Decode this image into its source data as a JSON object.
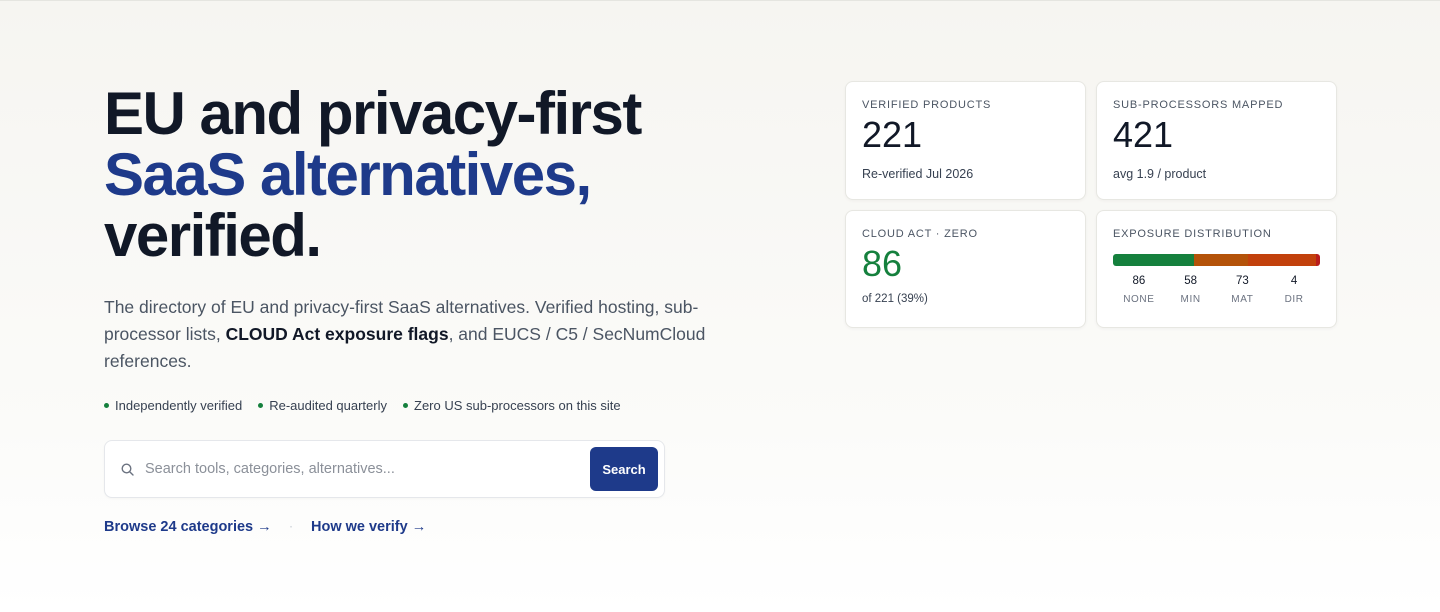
{
  "hero": {
    "headline_line1": "EU and privacy-first",
    "headline_line2": "SaaS alternatives,",
    "headline_line3": "verified.",
    "description_part1": "The directory of EU and privacy-first SaaS alternatives. Verified hosting, sub-processor lists, ",
    "description_strong": "CLOUD Act exposure flags",
    "description_part2": ", and EUCS / C5 / SecNumCloud references.",
    "badges": [
      "Independently verified",
      "Re-audited quarterly",
      "Zero US sub-processors on this site"
    ],
    "search": {
      "placeholder": "Search tools, categories, alternatives...",
      "value": "",
      "button_label": "Search",
      "icon": "search-icon"
    },
    "links": [
      "Browse 24 categories →",
      "How we verify →"
    ],
    "link_separator": "·"
  },
  "stats": {
    "verified_products": {
      "label": "VERIFIED PRODUCTS",
      "value": "221",
      "sub": "Re-verified Jul 2026"
    },
    "sub_processors": {
      "label": "SUB-PROCESSORS MAPPED",
      "value": "421",
      "sub": "avg 1.9 / product"
    },
    "cloud_act": {
      "label": "CLOUD ACT · ZERO",
      "value": "86",
      "sub": "of 221 (39%)"
    },
    "exposure": {
      "label": "EXPOSURE DISTRIBUTION",
      "segments": [
        {
          "count": 86,
          "label": "NONE",
          "color": "#15803d"
        },
        {
          "count": 58,
          "label": "MIN",
          "color": "#b45309"
        },
        {
          "count": 73,
          "label": "MAT",
          "color": "#c2410c"
        },
        {
          "count": 4,
          "label": "DIR",
          "color": "#b91c1c"
        }
      ]
    }
  },
  "colors": {
    "accent": "#1e3a8a",
    "success": "#15803d",
    "text": "#111827"
  }
}
